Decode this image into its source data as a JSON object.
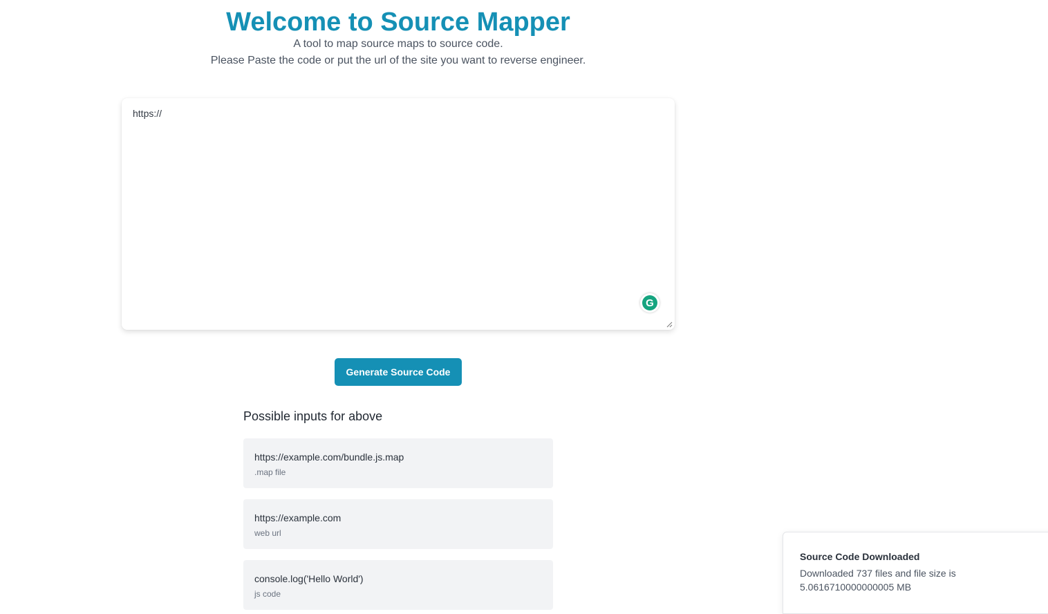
{
  "header": {
    "title": "Welcome to Source Mapper",
    "subtitle_line1": "A tool to map source maps to source code.",
    "subtitle_line2": "Please Paste the code or put the url of the site you want to reverse engineer."
  },
  "editor": {
    "value": "https://"
  },
  "generate_button": {
    "label": "Generate Source Code"
  },
  "examples": {
    "heading": "Possible inputs for above",
    "items": [
      {
        "value": "https://example.com/bundle.js.map",
        "type": ".map file"
      },
      {
        "value": "https://example.com",
        "type": "web url"
      },
      {
        "value": "console.log('Hello World')",
        "type": "js code"
      }
    ]
  },
  "toast": {
    "title": "Source Code Downloaded",
    "message": "Downloaded 737 files and file size is 5.0616710000000005 MB"
  },
  "colors": {
    "accent": "#1590b5",
    "grammarly": "#15a47f"
  }
}
